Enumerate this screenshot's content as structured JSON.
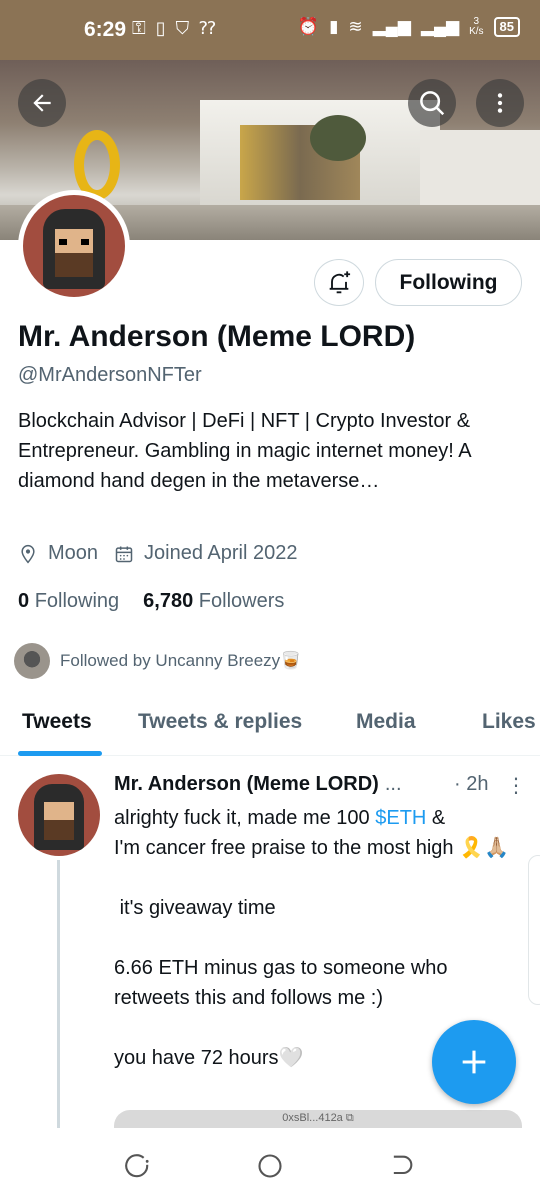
{
  "status_bar": {
    "time": "6:29",
    "network_speed_value": "3",
    "network_speed_unit": "K/s",
    "battery": "85"
  },
  "profile": {
    "display_name": "Mr. Anderson (Meme LORD)",
    "handle": "@MrAndersonNFTer",
    "bio": "Blockchain Advisor | DeFi | NFT | Crypto Investor & Entrepreneur.  Gambling in magic internet money! A diamond hand degen in the metaverse…",
    "location": "Moon",
    "joined": "Joined April 2022",
    "following_count": "0",
    "following_label": "Following",
    "followers_count": "6,780",
    "followers_label": "Followers",
    "followed_by": "Followed by Uncanny Breezy🥃",
    "follow_button_label": "Following"
  },
  "tabs": [
    {
      "label": "Tweets",
      "active": true
    },
    {
      "label": "Tweets & replies",
      "active": false
    },
    {
      "label": "Media",
      "active": false
    },
    {
      "label": "Likes",
      "active": false
    }
  ],
  "tweet": {
    "author": "Mr. Anderson (Meme LORD)",
    "ellipsis": "...",
    "time": "· 2h",
    "more": "⋮",
    "body_before_tag": "alrighty fuck it, made me 100 ",
    "cashtag": "$ETH",
    "body_after_tag": " &\nI'm cancer free praise to the most high 🎗️🙏🏼\n\n it's giveaway time\n\n6.66 ETH minus gas to someone who retweets this and follows me :)\n\nyou have 72 hours🤍",
    "media_caption": "0xsBl...412a"
  },
  "colors": {
    "accent": "#1d9bf0",
    "status_bar": "#8b7355",
    "secondary_text": "#536471"
  },
  "icons": {
    "back": "arrow-left-icon",
    "search": "search-icon",
    "more": "more-vertical-icon",
    "notify": "bell-plus-icon",
    "location": "location-pin-icon",
    "calendar": "calendar-icon",
    "compose": "plus-icon"
  }
}
